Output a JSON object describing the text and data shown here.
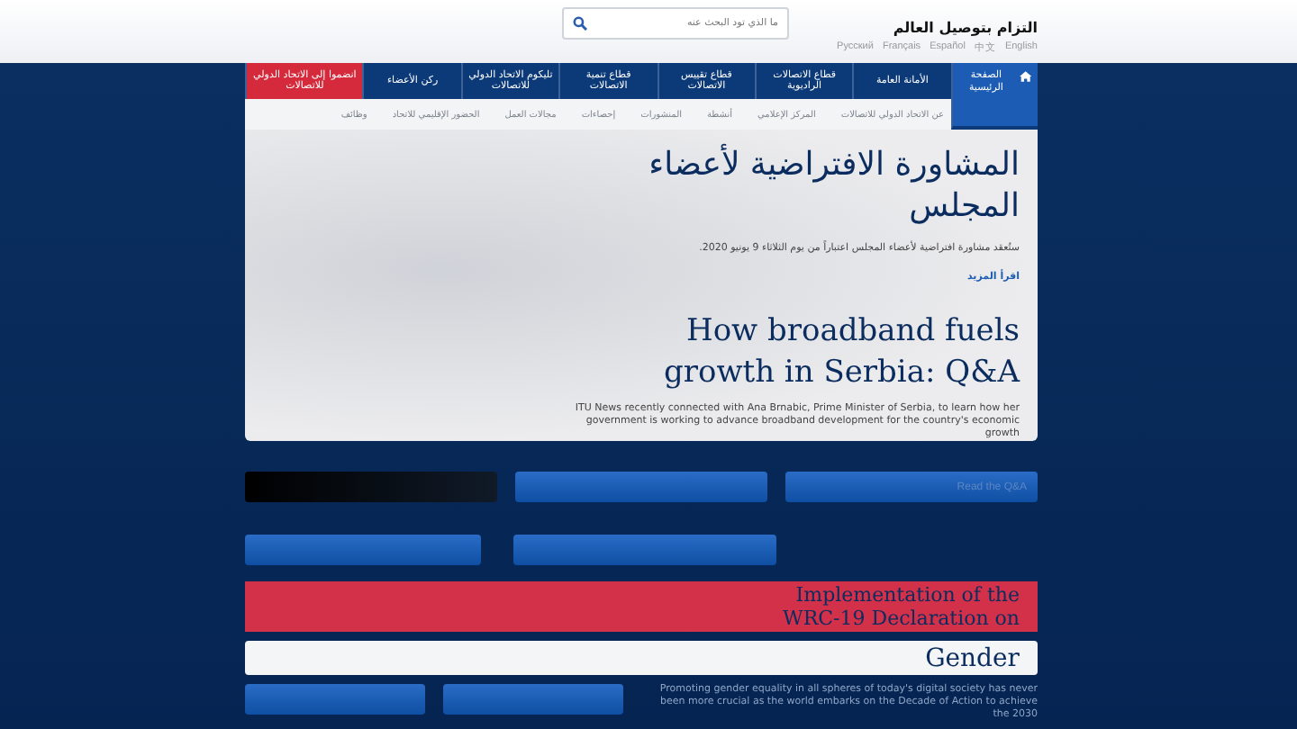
{
  "header": {
    "search": {
      "placeholder": "ما الذي تود البحث عنه"
    },
    "tagline": "التزام بتوصيل العالم",
    "languages": [
      "English",
      "中文",
      "Español",
      "Français",
      "Pусский"
    ]
  },
  "nav": [
    {
      "label": "الصفحة الرئيسية",
      "selected": true,
      "kind": "home"
    },
    {
      "label": "الأمانة العامة",
      "selected": false,
      "kind": "plain"
    },
    {
      "label": "قطاع الاتصالات الراديوية",
      "selected": false,
      "kind": "plain"
    },
    {
      "label": "قطاع تقييس الاتصالات",
      "selected": false,
      "kind": "plain"
    },
    {
      "label": "قطاع تنمية الاتصالات",
      "selected": false,
      "kind": "plain"
    },
    {
      "label": "تليكوم الاتحاد الدولي للاتصالات",
      "selected": false,
      "kind": "plain"
    },
    {
      "label": "ركن الأعضاء",
      "selected": false,
      "kind": "plain"
    },
    {
      "label": "انضموا إلى الاتحاد الدولي للاتصالات",
      "selected": false,
      "kind": "cta"
    }
  ],
  "subnav": [
    "عن الاتحاد الدولي للاتصالات",
    "المركز الإعلامي",
    "أنشطة",
    "المنشورات",
    "إحصاءات",
    "مجالات العمل",
    "الحضور الإقليمي للاتحاد",
    "وظائف"
  ],
  "news": [
    {
      "kind": "ar",
      "title": "المشاورة الافتراضية لأعضاء المجلس",
      "summary": "ستُعقد مشاورة افتراضية لأعضاء المجلس اعتباراً من يوم الثلاثاء 9 يونيو 2020.",
      "link": "اقرأ المزيد"
    },
    {
      "kind": "en",
      "title": "How broadband fuels growth in Serbia: Q&A",
      "summary": "ITU News recently connected with Ana Brnabic, Prime Minister of Serbia, to learn how her government is working to advance broadband development for the country's economic growth"
    }
  ],
  "buttons_row_1": [
    {
      "kind": "dark"
    },
    {
      "kind": "blue"
    },
    {
      "kind": "blue",
      "label": "Read the Q&A"
    }
  ],
  "buttons_row_2": [
    {
      "kind": "blue"
    },
    {
      "kind": "blue"
    }
  ],
  "feature": {
    "title_lines": [
      "Implementation of the",
      "WRC-19 Declaration on"
    ],
    "title_end": "Gender",
    "summary": "Promoting gender equality in all spheres of today's digital society has never been more crucial as the world embarks on the Decade of Action to achieve the 2030"
  },
  "buttons_row_3": [
    {
      "kind": "blue"
    },
    {
      "kind": "blue"
    }
  ]
}
